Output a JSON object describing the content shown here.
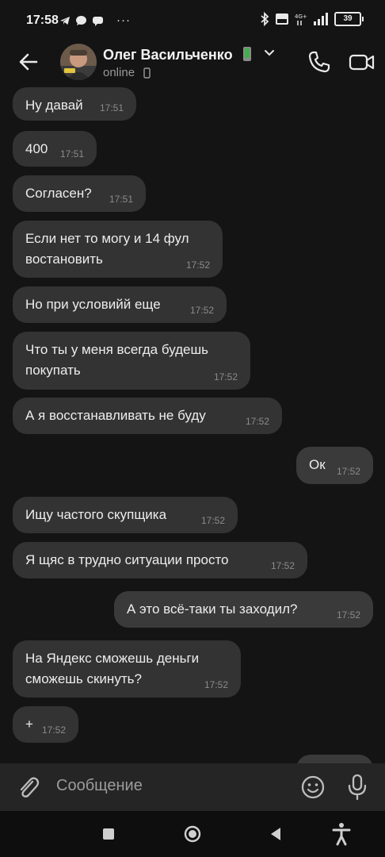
{
  "status_bar": {
    "time": "17:58",
    "battery": "39",
    "more": "···"
  },
  "header": {
    "name": "Олег Васильченко",
    "status": "online",
    "back_icon": "arrow-left-icon",
    "call_icon": "phone-icon",
    "video_icon": "video-camera-icon"
  },
  "messages": [
    {
      "text": "Ну давай",
      "time": "17:51",
      "dir": "in"
    },
    {
      "text": "400",
      "time": "17:51",
      "dir": "in"
    },
    {
      "text": "Согласен?",
      "time": "17:51",
      "dir": "in"
    },
    {
      "text": "Если нет то могу и 14 фул востановить",
      "time": "17:52",
      "dir": "in"
    },
    {
      "text": "Но при условийй еще",
      "time": "17:52",
      "dir": "in"
    },
    {
      "text": "Что ты у меня всегда будешь покупать",
      "time": "17:52",
      "dir": "in"
    },
    {
      "text": "А я восстанавливать не буду",
      "time": "17:52",
      "dir": "in"
    },
    {
      "text": "Ок",
      "time": "17:52",
      "dir": "out"
    },
    {
      "text": "Ищу частого скупщика",
      "time": "17:52",
      "dir": "in"
    },
    {
      "text": "Я щяс в трудно ситуации просто",
      "time": "17:52",
      "dir": "in"
    },
    {
      "text": "А это всё-таки ты заходил?",
      "time": "17:52",
      "dir": "out"
    },
    {
      "text": "На Яндекс сможешь деньги сможешь скинуть?",
      "time": "17:52",
      "dir": "in"
    },
    {
      "text": "+",
      "time": "17:52",
      "dir": "in"
    }
  ],
  "composer": {
    "placeholder": "Сообщение",
    "attach_icon": "paperclip-icon",
    "emoji_icon": "smiley-icon",
    "mic_icon": "microphone-icon"
  },
  "colors": {
    "background": "#141414",
    "bubble_in": "#333333",
    "bubble_out": "#3a3a3a",
    "composer_bg": "#252525"
  }
}
